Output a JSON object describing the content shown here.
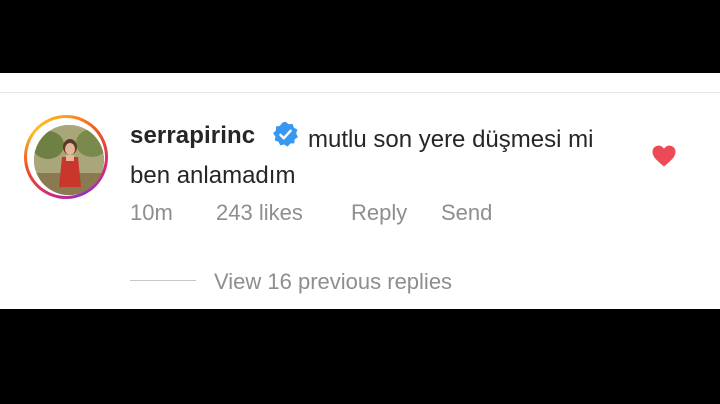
{
  "comment": {
    "username": "serrapirinc",
    "verified": true,
    "text": "mutlu son yere düşmesi mi ben anlamadım",
    "time": "10m",
    "likes": "243 likes",
    "reply_label": "Reply",
    "send_label": "Send",
    "liked": true
  },
  "replies": {
    "view_label": "View 16 previous replies"
  },
  "icons": {
    "verified": "verified-badge-icon",
    "heart": "heart-icon"
  },
  "colors": {
    "heart": "#ed4956",
    "verified": "#3897f0",
    "text": "#262626",
    "muted": "#8e8e8e"
  }
}
